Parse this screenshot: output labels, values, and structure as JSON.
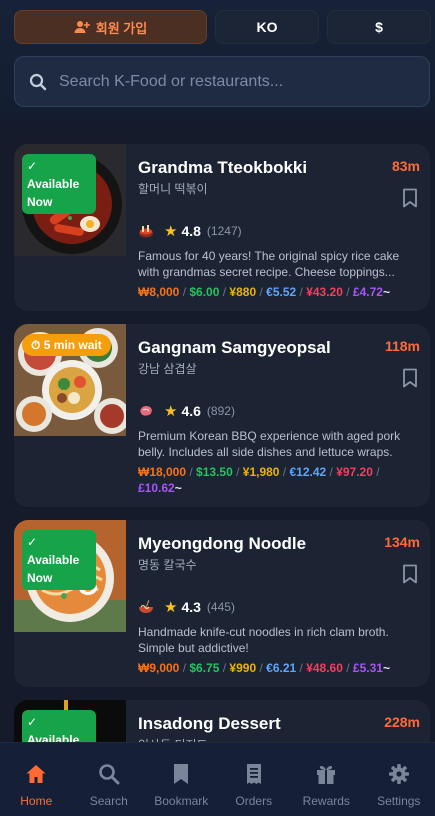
{
  "header": {
    "signup_label": "회원 가입",
    "language": "KO",
    "currency_symbol": "$"
  },
  "search": {
    "placeholder": "Search K-Food or restaurants..."
  },
  "restaurants": [
    {
      "name": "Grandma Tteokbokki",
      "name_local": "할머니 떡볶이",
      "distance": "83m",
      "badge": "✓ Available",
      "badge_now": "Now",
      "rating": "4.8",
      "review_count": "(1247)",
      "description_line1": "Famous for 40 years! The original spicy rice cake",
      "description_line2": "with grandmas secret recipe. Cheese toppings...",
      "prices": {
        "krw": "₩8,000",
        "usd": "$6.00",
        "jpy": "¥880",
        "eur": "€5.52",
        "cny": "¥43.20",
        "gbp": "£4.72",
        "more": "~"
      }
    },
    {
      "name": "Gangnam Samgyeopsal",
      "name_local": "강남 삼겹살",
      "distance": "118m",
      "badge": "⏱ 5 min wait",
      "rating": "4.6",
      "review_count": "(892)",
      "description_line1": "Premium Korean BBQ experience with aged pork",
      "description_line2": "belly. Includes all side dishes and lettuce wraps.",
      "prices": {
        "krw": "₩18,000",
        "usd": "$13.50",
        "jpy": "¥1,980",
        "eur": "€12.42",
        "cny": "¥97.20",
        "gbp": "£10.62",
        "more": "~"
      }
    },
    {
      "name": "Myeongdong Noodle",
      "name_local": "명동 칼국수",
      "distance": "134m",
      "badge": "✓ Available",
      "badge_now": "Now",
      "rating": "4.3",
      "review_count": "(445)",
      "description_line1": "Handmade knife-cut noodles in rich clam broth.",
      "description_line2": "Simple but addictive!",
      "prices": {
        "krw": "₩9,000",
        "usd": "$6.75",
        "jpy": "¥990",
        "eur": "€6.21",
        "cny": "¥48.60",
        "gbp": "£5.31",
        "more": "~"
      }
    },
    {
      "name": "Insadong Dessert",
      "name_local": "인사동 디저트",
      "distance": "228m",
      "badge": "✓ Available"
    }
  ],
  "nav": {
    "items": [
      {
        "label": "Home",
        "icon": "home-icon"
      },
      {
        "label": "Search",
        "icon": "search-icon"
      },
      {
        "label": "Bookmark",
        "icon": "bookmark-icon"
      },
      {
        "label": "Orders",
        "icon": "receipt-icon"
      },
      {
        "label": "Rewards",
        "icon": "gift-icon"
      },
      {
        "label": "Settings",
        "icon": "gear-icon"
      }
    ],
    "active_index": 0
  },
  "colors": {
    "accent": "#ff6b35",
    "available": "#16a34a",
    "wait": "#f59e0b",
    "background": "#151b2b",
    "card": "#1c2333"
  }
}
